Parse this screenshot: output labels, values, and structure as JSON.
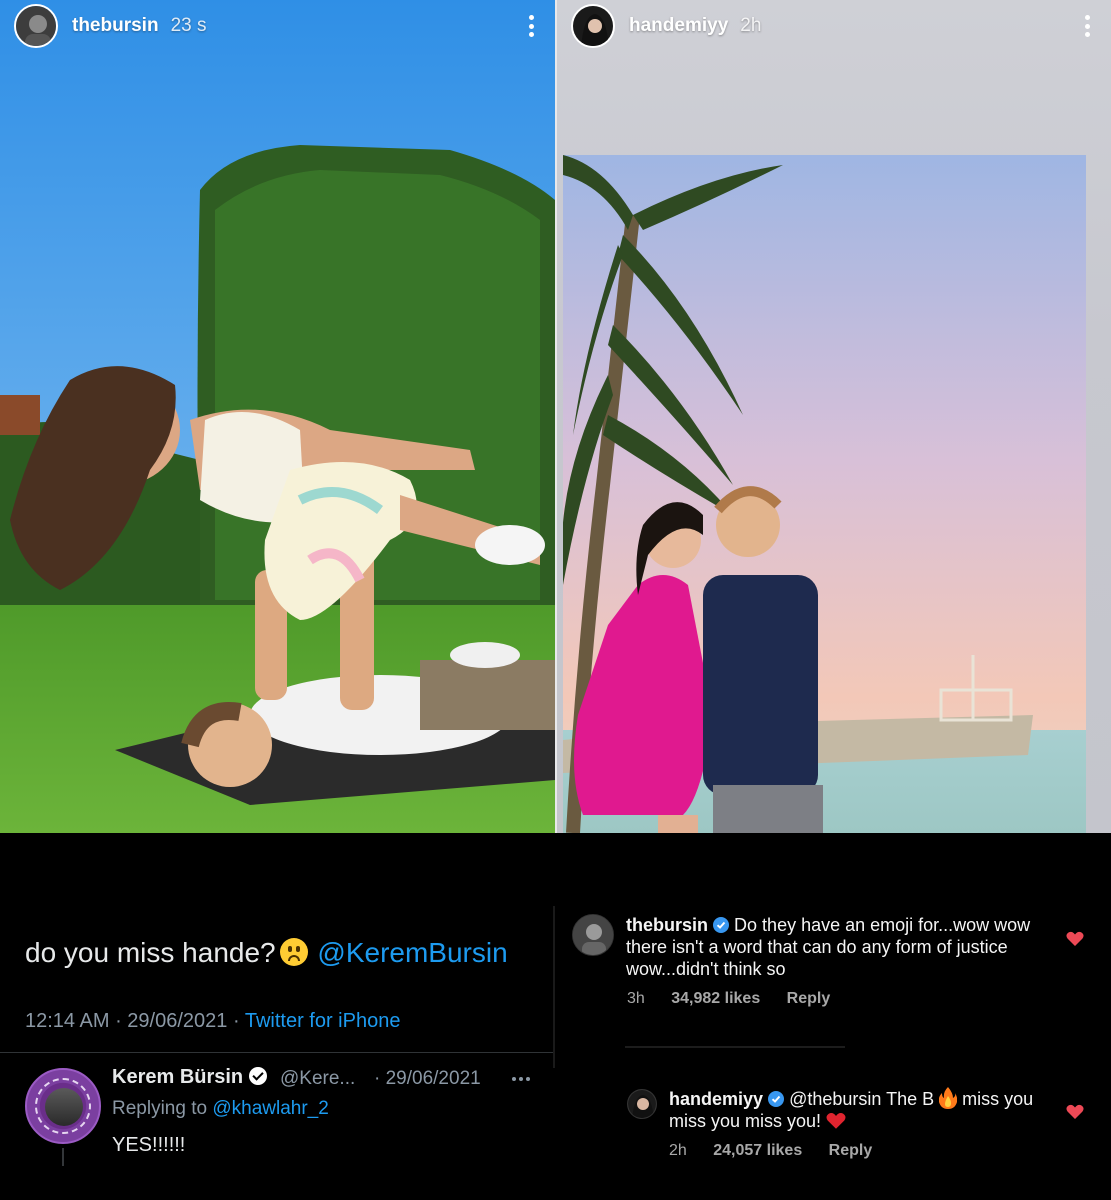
{
  "stories": {
    "left": {
      "username": "thebursin",
      "time": "23 s"
    },
    "right": {
      "username": "handemiyy",
      "time": "2h"
    }
  },
  "tweet": {
    "text": "do you miss hande?",
    "mention": "@KeremBursin",
    "time": "12:14 AM",
    "date": "29/06/2021",
    "source": "Twitter for iPhone",
    "reply": {
      "name": "Kerem Bürsin",
      "handle": "@Kere...",
      "date": "· 29/06/2021",
      "replying_label": "Replying to",
      "replying_to": "@khawlahr_2",
      "body": "YES!!!!!!"
    }
  },
  "comments": [
    {
      "username": "thebursin",
      "text": "Do they have an emoji for...wow wow there isn't a word that can do any form of justice wow...didn't think so",
      "age": "3h",
      "likes": "34,982 likes",
      "reply_label": "Reply"
    },
    {
      "username": "handemiyy",
      "text_a": "@thebursin The B",
      "text_b": "miss you miss you miss you!",
      "age": "2h",
      "likes": "24,057 likes",
      "reply_label": "Reply"
    }
  ],
  "colors": {
    "twitter_blue": "#1d9bf0",
    "heart_red": "#ed4956",
    "verified_blue": "#3897f0"
  }
}
